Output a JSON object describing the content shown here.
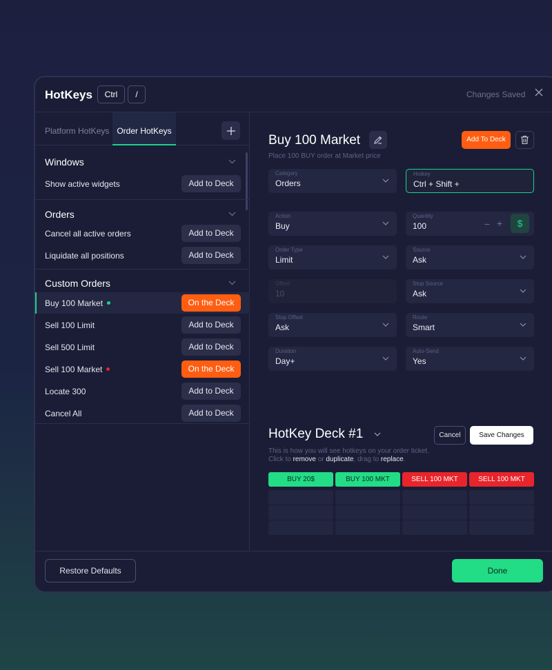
{
  "header": {
    "title": "HotKeys",
    "key1": "Ctrl",
    "key2": "/",
    "status": "Changes Saved",
    "close_icon": "close-icon"
  },
  "tabs": [
    "Platform HotKeys",
    "Order HotKeys"
  ],
  "sections": [
    {
      "title": "Windows",
      "rows": [
        {
          "label": "Show active widgets",
          "button": "Add to Deck"
        }
      ]
    },
    {
      "title": "Orders",
      "rows": [
        {
          "label": "Cancel all active orders",
          "button": "Add to Deck"
        },
        {
          "label": "Liquidate all positions",
          "button": "Add to Deck"
        }
      ]
    },
    {
      "title": "Custom Orders",
      "rows": [
        {
          "label": "Buy 100 Market",
          "button": "On the Deck"
        },
        {
          "label": "Sell 100 Limit",
          "button": "Add to Deck"
        },
        {
          "label": "Sell 500 Limit",
          "button": "Add to Deck"
        },
        {
          "label": "Sell 100 Market",
          "button": "On the Deck"
        },
        {
          "label": "Locate 300",
          "button": "Add to Deck"
        },
        {
          "label": "Cancel All",
          "button": "Add to Deck"
        }
      ]
    }
  ],
  "order": {
    "title": "Buy 100 Market",
    "subtitle": "Place 100 BUY order at Market price",
    "add_to_deck": "Add To Deck"
  },
  "fields": {
    "category": {
      "label": "Category",
      "value": "Orders"
    },
    "hotkey": {
      "label": "Hotkey",
      "value": "Ctrl + Shift +"
    },
    "action": {
      "label": "Action",
      "value": "Buy"
    },
    "quantity": {
      "label": "Quantity",
      "value": "100",
      "minus": "−",
      "plus": "+",
      "dollar": "$"
    },
    "order_type": {
      "label": "Order Type",
      "value": "Limit"
    },
    "source": {
      "label": "Source",
      "value": "Ask"
    },
    "offset": {
      "label": "Offset",
      "value": "10"
    },
    "stop_source": {
      "label": "Stop Source",
      "value": "Ask"
    },
    "stop_offset": {
      "label": "Stop Offset",
      "value": "Ask"
    },
    "route": {
      "label": "Route",
      "value": "Smart"
    },
    "duration": {
      "label": "Duration",
      "value": "Day+"
    },
    "auto_send": {
      "label": "Auto-Send",
      "value": "Yes"
    }
  },
  "deck": {
    "title": "HotKey Deck #1",
    "subtitle1": "This is how you will see hotkeys on your order ticket.",
    "sub2_a": "Click to ",
    "sub2_remove": "remove",
    "sub2_or": " or ",
    "sub2_duplicate": "duplicate",
    "sub2_drag": ", drag to ",
    "sub2_replace": "replace",
    "sub2_end": ".",
    "cancel": "Cancel",
    "save": "Save Changes",
    "cells": [
      "BUY 20$",
      "BUY 100 MKT",
      "SELL 100 MKT",
      "SELL 100 MKT"
    ]
  },
  "footer": {
    "restore": "Restore Defaults",
    "done": "Done"
  },
  "colors": {
    "accent_green": "#22dc86",
    "accent_orange": "#ff5e12",
    "sell_red": "#e8252b"
  }
}
